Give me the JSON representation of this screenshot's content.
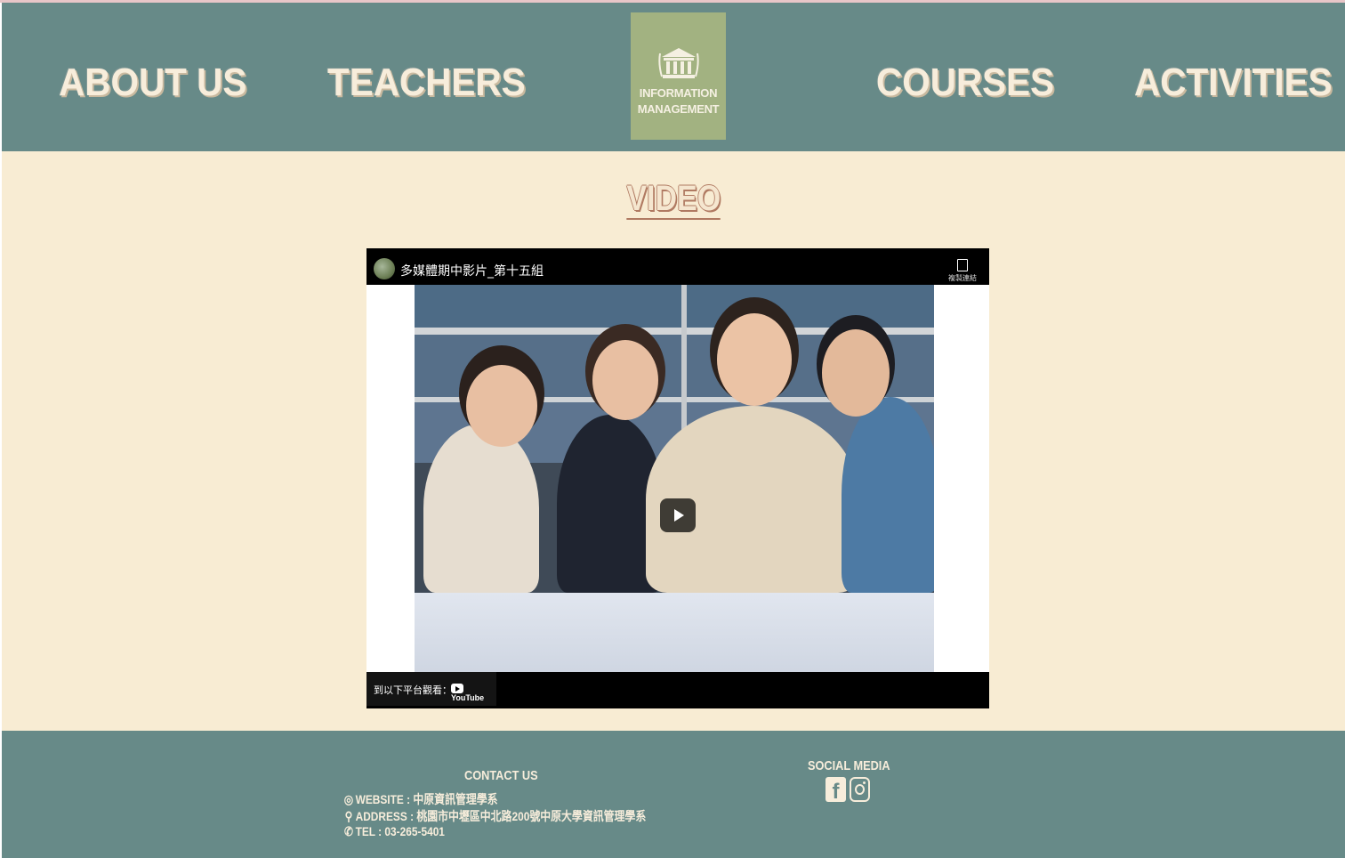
{
  "nav": {
    "about": "ABOUT US",
    "teachers": "TEACHERS",
    "courses": "COURSES",
    "activities": "ACTIVITIES"
  },
  "logo": {
    "line1": "INFORMATION",
    "line2": "MANAGEMENT",
    "icon": "building-columns-icon"
  },
  "section": {
    "title": "VIDEO"
  },
  "video": {
    "title": "多媒體期中影片_第十五組",
    "copy_label": "複製連結",
    "watch_on": "到以下平台觀看：",
    "platform": "YouTube"
  },
  "footer": {
    "contact_title": "CONTACT US",
    "website": "WEBSITE : 中原資訊管理學系",
    "address": "ADDRESS : 桃園市中壢區中北路200號中原大學資訊管理學系",
    "tel": "TEL : 03-265-5401",
    "social_title": "SOCIAL MEDIA"
  },
  "colors": {
    "header_bg": "#678a88",
    "page_bg": "#f8ecd3",
    "logo_bg": "#a2b281",
    "title_accent": "#b07a62"
  }
}
